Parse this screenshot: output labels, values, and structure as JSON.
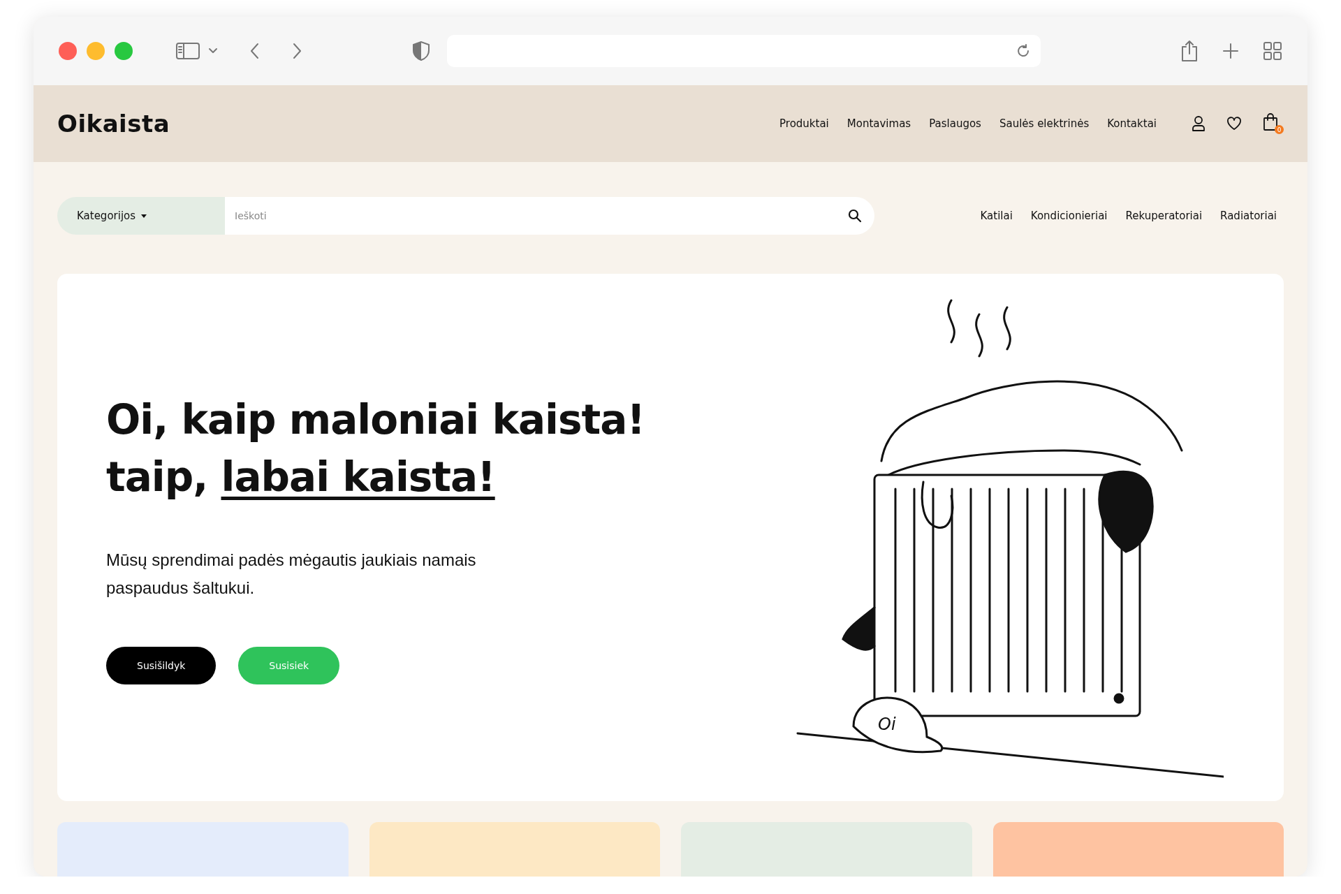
{
  "header": {
    "logo": "Oikaista",
    "nav": [
      "Produktai",
      "Montavimas",
      "Paslaugos",
      "Saulės elektrinės",
      "Kontaktai"
    ],
    "cart_count": "0"
  },
  "search": {
    "category_label": "Kategorijos",
    "placeholder": "Ieškoti"
  },
  "quick_links": [
    "Katilai",
    "Kondicionieriai",
    "Rekuperatoriai",
    "Radiatoriai"
  ],
  "hero": {
    "title_line_1": "Oi, kaip maloniai kaista!",
    "title_line_2_prefix": "taip,",
    "title_line_2_link": "labai kaista!",
    "text": "Mūsų sprendimai padės mėgautis jaukiais namais paspaudus šaltukui.",
    "buttons": [
      {
        "label": "Susišildyk",
        "kind": "dark"
      },
      {
        "label": "Susisiek",
        "kind": "green"
      }
    ],
    "cap_text": "Oi"
  },
  "cards": [
    {
      "color": "#e4ecfb"
    },
    {
      "color": "#fde8c4"
    },
    {
      "color": "#e4ede4"
    },
    {
      "color": "#fec3a1"
    }
  ]
}
